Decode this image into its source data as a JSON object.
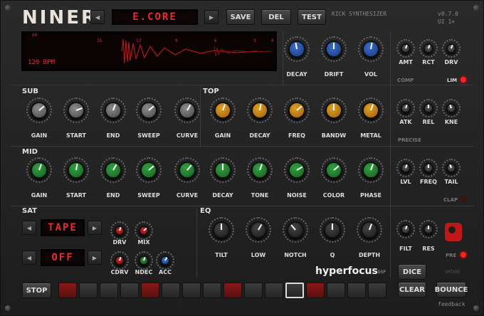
{
  "header": {
    "logo": "NINER",
    "preset": "E.CORE",
    "save": "SAVE",
    "del": "DEL",
    "test": "TEST",
    "subtitle": "KICK SYNTHESIZER",
    "version": "v0.7.0",
    "ui": "UI 1×"
  },
  "scope": {
    "ticks": [
      "60",
      "15",
      "12",
      "9",
      "6",
      "3",
      "0"
    ],
    "bpm": "120 BPM"
  },
  "top_right": {
    "knobs": [
      "DECAY",
      "DRIFT",
      "VOL"
    ],
    "comp_knobs": [
      "AMT",
      "RCT",
      "DRV"
    ],
    "comp": "COMP",
    "lim": "LIM"
  },
  "sub": {
    "title": "SUB",
    "knobs": [
      "GAIN",
      "START",
      "END",
      "SWEEP",
      "CURVE"
    ]
  },
  "top": {
    "title": "TOP",
    "knobs": [
      "GAIN",
      "DECAY",
      "FREQ",
      "BANDW",
      "METAL"
    ],
    "side": [
      "ATK",
      "REL",
      "KNE"
    ],
    "precise": "PRECISE"
  },
  "mid": {
    "title": "MID",
    "knobs": [
      "GAIN",
      "START",
      "END",
      "SWEEP",
      "CURVE",
      "DECAY",
      "TONE",
      "NOISE",
      "COLOR",
      "PHASE"
    ],
    "side": [
      "LVL",
      "FREQ",
      "TAIL"
    ],
    "clap": "CLAP"
  },
  "sat": {
    "title": "SAT",
    "mode": "TAPE",
    "mode2": "OFF",
    "knobs": [
      "DRV",
      "MIX",
      "CDRV",
      "NDEC",
      "ACC"
    ]
  },
  "eq": {
    "title": "EQ",
    "knobs": [
      "TILT",
      "LOW",
      "NOTCH",
      "Q",
      "DEPTH"
    ],
    "side": [
      "FILT",
      "RES"
    ],
    "pre": "PRE"
  },
  "brand": {
    "name": "hyperfocus",
    "suffix": "DSP",
    "smtxee": "SMTXEE"
  },
  "footer": {
    "stop": "STOP",
    "dice": "DICE",
    "clear": "CLEAR",
    "bounce": "BOUNCE",
    "feedback": "feedback"
  },
  "steps": [
    true,
    false,
    false,
    false,
    true,
    false,
    false,
    false,
    true,
    false,
    false,
    false,
    true,
    false,
    false,
    false
  ],
  "current_step": 11
}
